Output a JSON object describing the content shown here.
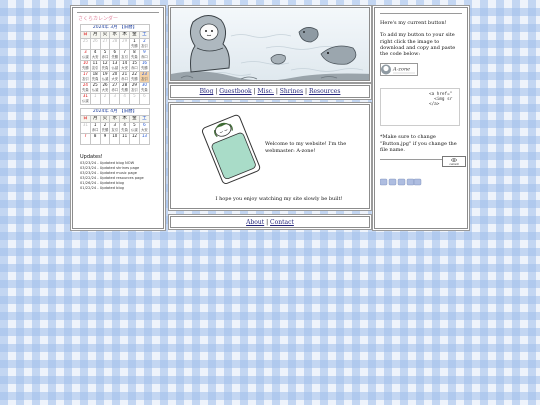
{
  "calendar": {
    "title": "さくらカレンダー",
    "weekday_headers": [
      "日",
      "月",
      "火",
      "水",
      "木",
      "金",
      "土"
    ],
    "months": [
      {
        "caption": "2024年 3月 【旧暦】",
        "weeks": [
          [
            {
              "d": "25",
              "o": true
            },
            {
              "d": "26",
              "o": true
            },
            {
              "d": "27",
              "o": true
            },
            {
              "d": "28",
              "o": true
            },
            {
              "d": "29",
              "o": true
            },
            {
              "d": "1",
              "r": "先勝"
            },
            {
              "d": "2",
              "r": "友引"
            }
          ],
          [
            {
              "d": "3",
              "r": "仏滅"
            },
            {
              "d": "4",
              "r": "大安"
            },
            {
              "d": "5",
              "r": "赤口"
            },
            {
              "d": "6",
              "r": "先勝"
            },
            {
              "d": "7",
              "r": "友引"
            },
            {
              "d": "8",
              "r": "先負"
            },
            {
              "d": "9",
              "r": "赤口"
            }
          ],
          [
            {
              "d": "10",
              "r": "先勝"
            },
            {
              "d": "11",
              "r": "友引"
            },
            {
              "d": "12",
              "r": "先負"
            },
            {
              "d": "13",
              "r": "仏滅"
            },
            {
              "d": "14",
              "r": "大安"
            },
            {
              "d": "15",
              "r": "赤口"
            },
            {
              "d": "16",
              "r": "先勝"
            }
          ],
          [
            {
              "d": "17",
              "r": "友引"
            },
            {
              "d": "18",
              "r": "先負"
            },
            {
              "d": "19",
              "r": "仏滅"
            },
            {
              "d": "20",
              "r": "大安"
            },
            {
              "d": "21",
              "r": "赤口"
            },
            {
              "d": "22",
              "r": "先勝"
            },
            {
              "d": "23",
              "r": "友引",
              "hl": true
            }
          ],
          [
            {
              "d": "24",
              "r": "先負"
            },
            {
              "d": "25",
              "r": "仏滅"
            },
            {
              "d": "26",
              "r": "大安"
            },
            {
              "d": "27",
              "r": "赤口"
            },
            {
              "d": "28",
              "r": "先勝"
            },
            {
              "d": "29",
              "r": "友引"
            },
            {
              "d": "30",
              "r": "先負"
            }
          ],
          [
            {
              "d": "31",
              "r": "仏滅"
            },
            {
              "d": "1",
              "o": true
            },
            {
              "d": "2",
              "o": true
            },
            {
              "d": "3",
              "o": true
            },
            {
              "d": "4",
              "o": true
            },
            {
              "d": "5",
              "o": true
            },
            {
              "d": "6",
              "o": true
            }
          ]
        ]
      },
      {
        "caption": "2024年 4月 【旧暦】",
        "weeks": [
          [
            {
              "d": "31",
              "o": true
            },
            {
              "d": "1",
              "r": "赤口"
            },
            {
              "d": "2",
              "r": "先勝"
            },
            {
              "d": "3",
              "r": "友引"
            },
            {
              "d": "4",
              "r": "先負"
            },
            {
              "d": "5",
              "r": "仏滅"
            },
            {
              "d": "6",
              "r": "大安"
            }
          ],
          [
            {
              "d": "7"
            },
            {
              "d": "8"
            },
            {
              "d": "9"
            },
            {
              "d": "10"
            },
            {
              "d": "11"
            },
            {
              "d": "12"
            },
            {
              "d": "13"
            }
          ]
        ]
      }
    ]
  },
  "updates": {
    "title": "Updates!",
    "items": [
      "03/23/24 - Updated blog NOW",
      "03/23/24 - Updated shrines page",
      "03/23/24 - Updated music page",
      "03/22/24 - Updated resources page",
      "01/26/24 - Updated blog",
      "01/22/24 - Updated blog"
    ]
  },
  "nav": {
    "links": [
      "Blog",
      "Guestbook",
      "Misc.",
      "Shrines",
      "Resources"
    ],
    "sep": "|"
  },
  "main": {
    "welcome_line1": "Welcome to my website! I'm the",
    "welcome_line2": "webmaster: A-zone!",
    "enjoy": "I hope you enjoy watching my site slowly be built!"
  },
  "footer": {
    "about": "About",
    "contact": "Contact",
    "sep": "|"
  },
  "right": {
    "heading": "Here's my current button!",
    "instructions": "To add my button to your site right click the image to download and copy and paste the code below:",
    "button_text": "A-zone",
    "code_snippet": "<a href=\"\n  <img sr\n</a>",
    "note": "*Make sure to change \"Button.jpg\" if you change the file name.",
    "mini_button": "current"
  }
}
